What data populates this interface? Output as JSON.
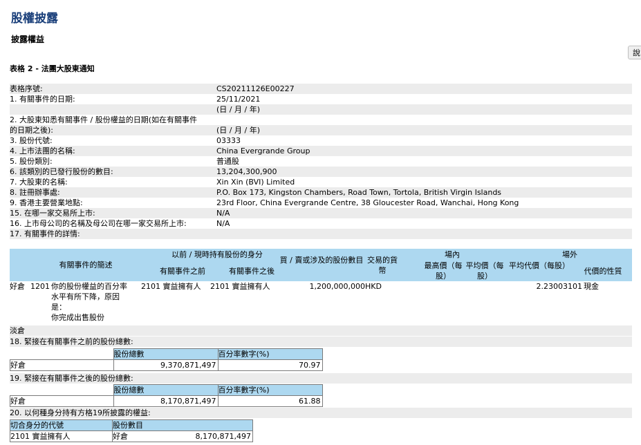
{
  "header": {
    "title": "股權披露",
    "subtitle": "披露權益",
    "side_button": "說",
    "form_title": "表格 2 - 法團大股東通知"
  },
  "info_rows": [
    {
      "label": "表格序號:",
      "value": "CS20211126E00227"
    },
    {
      "label": "1. 有關事件的日期:",
      "value": "25/11/2021"
    },
    {
      "label": "",
      "value": "(日 / 月 / 年)"
    },
    {
      "label": "2. 大股東知悉有關事件 / 股份權益的日期(如在有關事件",
      "value": ""
    },
    {
      "label": "的日期之後):",
      "value": "(日 / 月 / 年)"
    },
    {
      "label": "3. 股份代號:",
      "value": "03333"
    },
    {
      "label": "4. 上市法團的名稱:",
      "value": "China Evergrande Group"
    },
    {
      "label": "5. 股份類別:",
      "value": "普通股"
    },
    {
      "label": "6. 該類別的已發行股份的數目:",
      "value": "13,204,300,900"
    },
    {
      "label": "7. 大股東的名稱:",
      "value": "Xin Xin (BVI) Limited"
    },
    {
      "label": "8. 註冊辦事處:",
      "value": "P.O. Box 173, Kingston Chambers, Road Town, Tortola, British Virgin Islands"
    },
    {
      "label": "9. 香港主要營業地點:",
      "value": "23rd Floor, China Evergrande Centre, 38 Gloucester Road, Wanchai, Hong Kong"
    },
    {
      "label": "15. 在哪一家交易所上市:",
      "value": "N/A"
    },
    {
      "label": "16. 上市母公司的名稱及母公司在哪一家交易所上市:",
      "value": "N/A"
    },
    {
      "label": "17. 有關事件的詳情:",
      "value": ""
    }
  ],
  "detail_header": {
    "event_desc": "有關事件的簡述",
    "capacity_group": "以前 / 現時持有股份的身分",
    "before": "有關事件之前",
    "after": "有關事件之後",
    "shares_involved": "買 / 賣或涉及的股份數目",
    "currency": "交易的貨幣",
    "on_exchange": "場內",
    "highest_price": "最高價（每股）",
    "avg_price": "平均價（每股）",
    "off_exchange": "場外",
    "avg_consideration": "平均代價（每股）",
    "nature": "代價的性質"
  },
  "detail_row": {
    "position": "好倉",
    "code": "1201",
    "desc_lines": [
      "你的股份權益的百分率",
      "水平有所下降，原因",
      "是：",
      "你完成出售股份"
    ],
    "before": "2101 實益擁有人",
    "after": "2101 實益擁有人",
    "shares": "1,200,000,000",
    "currency": "HKD",
    "avg_consideration": "2.23003101",
    "nature": "現金"
  },
  "short_label": "淡倉",
  "section18": {
    "title": "18. 緊接在有關事件之前的股份總數:",
    "col_shares": "股份總數",
    "col_pct": "百分率數字(%)",
    "row_label": "好倉",
    "shares": "9,370,871,497",
    "pct": "70.97"
  },
  "section19": {
    "title": "19. 緊接在有關事件之後的股份總數:",
    "col_shares": "股份總數",
    "col_pct": "百分率數字(%)",
    "row_label": "好倉",
    "shares": "8,170,871,497",
    "pct": "61.88"
  },
  "section20": {
    "title": "20. 以何種身分持有方格19所披露的權益:",
    "col_code": "切合身分的代號",
    "col_shares": "股份數目",
    "code": "2101",
    "capacity": "實益擁有人",
    "position": "好倉",
    "shares": "8,170,871,497"
  }
}
